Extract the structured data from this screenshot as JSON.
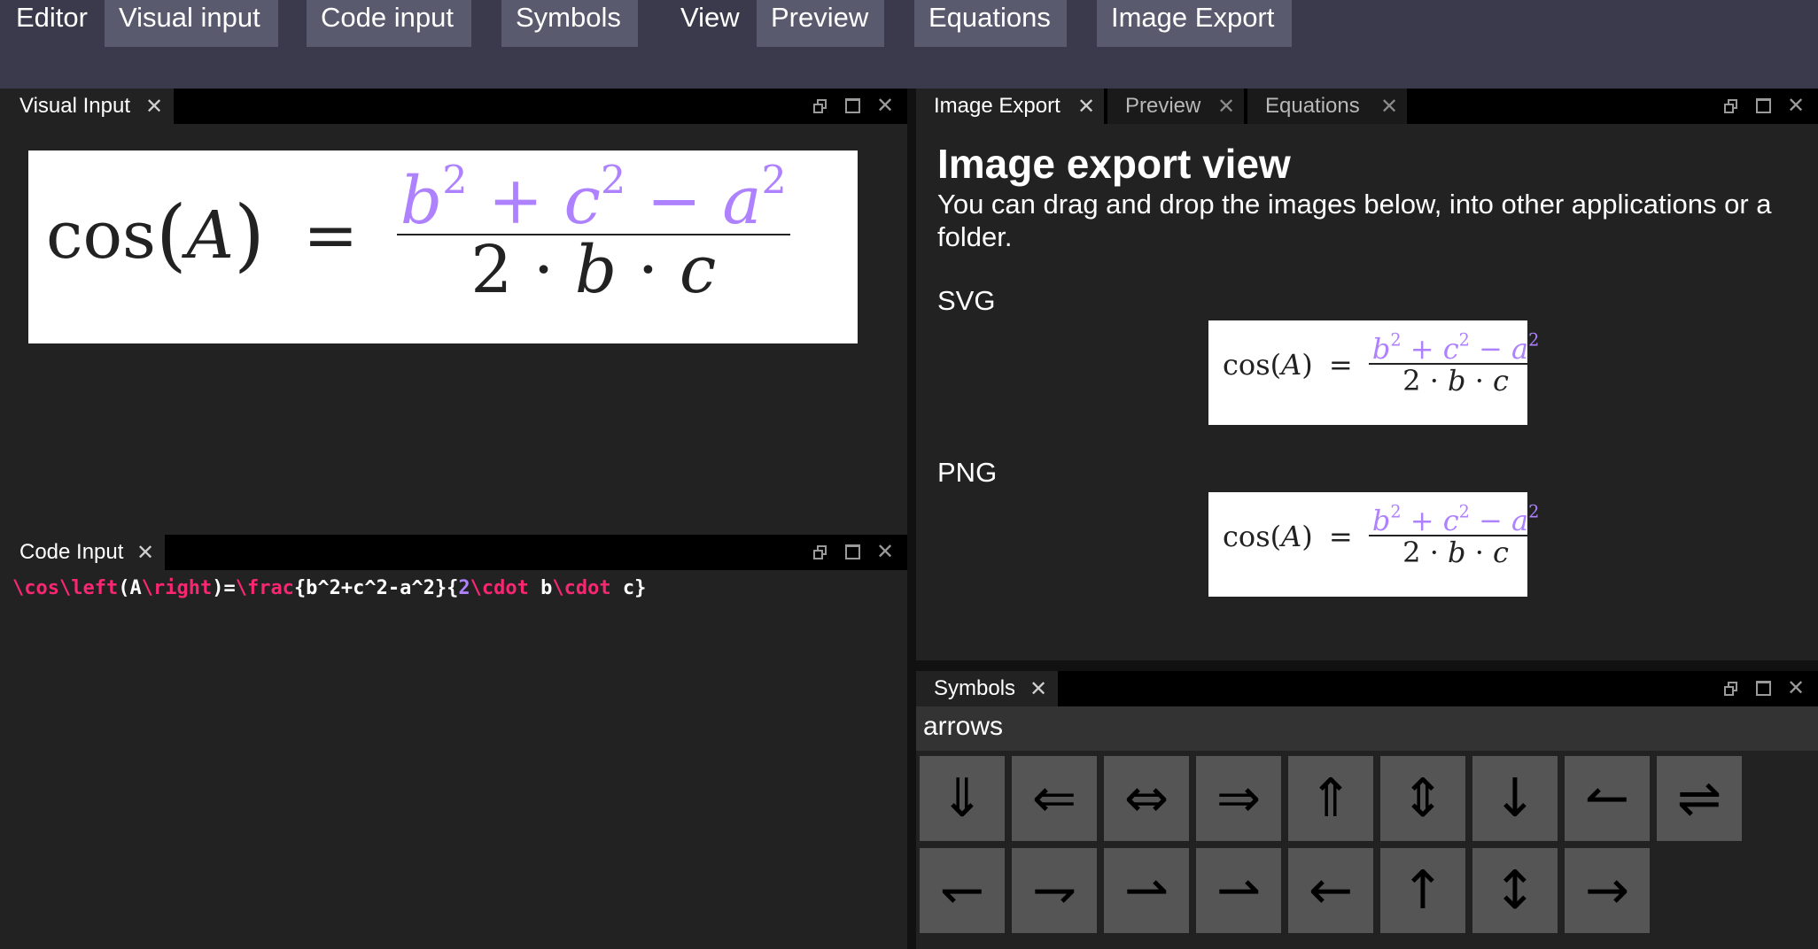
{
  "menu": {
    "editor": "Editor",
    "visual_input": "Visual input",
    "code_input": "Code input",
    "symbols": "Symbols",
    "view": "View",
    "preview": "Preview",
    "equations": "Equations",
    "image_export": "Image Export"
  },
  "visual_input_panel": {
    "tab": "Visual Input",
    "close": "✕",
    "formula": {
      "lhs": "cos",
      "arg": "A",
      "eq": "=",
      "num_b": "b",
      "num_c": "c",
      "num_a": "a",
      "exp": "2",
      "plus": "+",
      "minus": "−",
      "den_2": "2",
      "den_b": "b",
      "den_c": "c",
      "dot": "·"
    }
  },
  "code_input_panel": {
    "tab": "Code Input",
    "close": "✕",
    "code": {
      "t1": "\\cos",
      "t2": "\\left",
      "t3": "(A",
      "t4": "\\right",
      "t5": ")=",
      "t6": "\\frac",
      "t7": "{b^2+c^2-a^2}{",
      "t8": "2",
      "t9": "\\cdot",
      "t10": " b",
      "t11": "\\cdot",
      "t12": " c}"
    }
  },
  "right_tabs": {
    "image_export": "Image Export",
    "preview": "Preview",
    "equations": "Equations",
    "close": "✕"
  },
  "image_export_view": {
    "title": "Image export view",
    "description": "You can drag and drop the images below, into other applications or a folder.",
    "svg_label": "SVG",
    "png_label": "PNG"
  },
  "symbols_panel": {
    "tab": "Symbols",
    "close": "✕",
    "category": "arrows",
    "row1": [
      "⇓",
      "⇐",
      "⇔",
      "⇒",
      "⇑",
      "⇕",
      "↓",
      "↼",
      "⇌"
    ],
    "row2": [
      "↽",
      "⇁",
      "⇀",
      "⇀",
      "←",
      "↑",
      "↕",
      "→"
    ]
  },
  "colors": {
    "menubar": "#3a3a4c",
    "menu_button": "#5a5a6e",
    "panel_bg": "#222222",
    "tabstrip": "#000000",
    "symbol_tile": "#555555",
    "code_keyword": "#f92672",
    "code_number": "#ae81ff"
  },
  "icons": [
    "restore-icon",
    "maximize-icon",
    "close-icon"
  ]
}
